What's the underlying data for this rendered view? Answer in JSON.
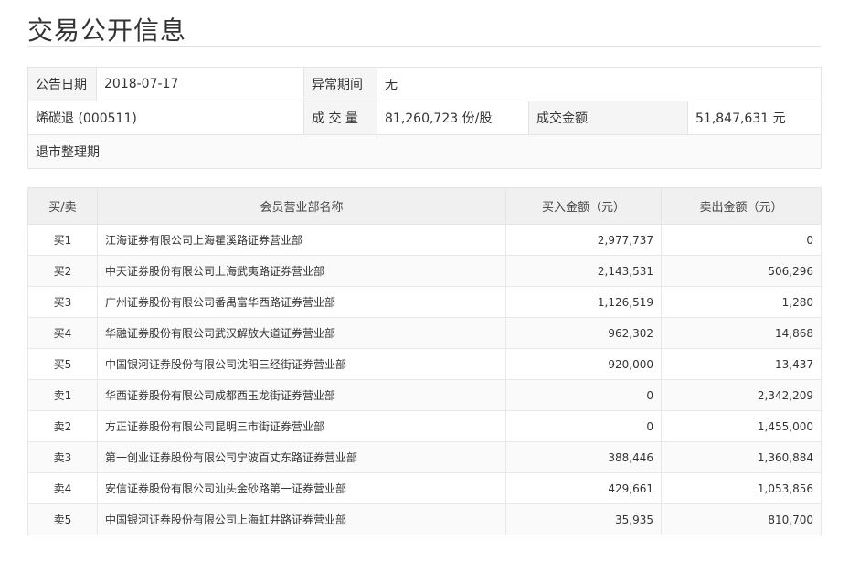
{
  "page_title": "交易公开信息",
  "info": {
    "date_label": "公告日期",
    "date_value": "2018-07-17",
    "period_label": "异常期间",
    "period_value": "无",
    "stock_name": "烯碳退 (000511)",
    "volume_label": "成 交 量",
    "volume_value": "81,260,723 份/股",
    "amount_label": "成交金额",
    "amount_value": "51,847,631 元",
    "reason": "退市整理期"
  },
  "table": {
    "headers": [
      "买/卖",
      "会员营业部名称",
      "买入金额（元）",
      "卖出金额（元）"
    ],
    "rows": [
      {
        "side": "买1",
        "name": "江海证券有限公司上海瞿溪路证券营业部",
        "buy": "2,977,737",
        "sell": "0"
      },
      {
        "side": "买2",
        "name": "中天证券股份有限公司上海武夷路证券营业部",
        "buy": "2,143,531",
        "sell": "506,296"
      },
      {
        "side": "买3",
        "name": "广州证券股份有限公司番禺富华西路证券营业部",
        "buy": "1,126,519",
        "sell": "1,280"
      },
      {
        "side": "买4",
        "name": "华融证券股份有限公司武汉解放大道证券营业部",
        "buy": "962,302",
        "sell": "14,868"
      },
      {
        "side": "买5",
        "name": "中国银河证券股份有限公司沈阳三经街证券营业部",
        "buy": "920,000",
        "sell": "13,437"
      },
      {
        "side": "卖1",
        "name": "华西证券股份有限公司成都西玉龙街证券营业部",
        "buy": "0",
        "sell": "2,342,209"
      },
      {
        "side": "卖2",
        "name": "方正证券股份有限公司昆明三市街证券营业部",
        "buy": "0",
        "sell": "1,455,000"
      },
      {
        "side": "卖3",
        "name": "第一创业证券股份有限公司宁波百丈东路证券营业部",
        "buy": "388,446",
        "sell": "1,360,884"
      },
      {
        "side": "卖4",
        "name": "安信证券股份有限公司汕头金砂路第一证券营业部",
        "buy": "429,661",
        "sell": "1,053,856"
      },
      {
        "side": "卖5",
        "name": "中国银河证券股份有限公司上海虹井路证券营业部",
        "buy": "35,935",
        "sell": "810,700"
      }
    ]
  }
}
